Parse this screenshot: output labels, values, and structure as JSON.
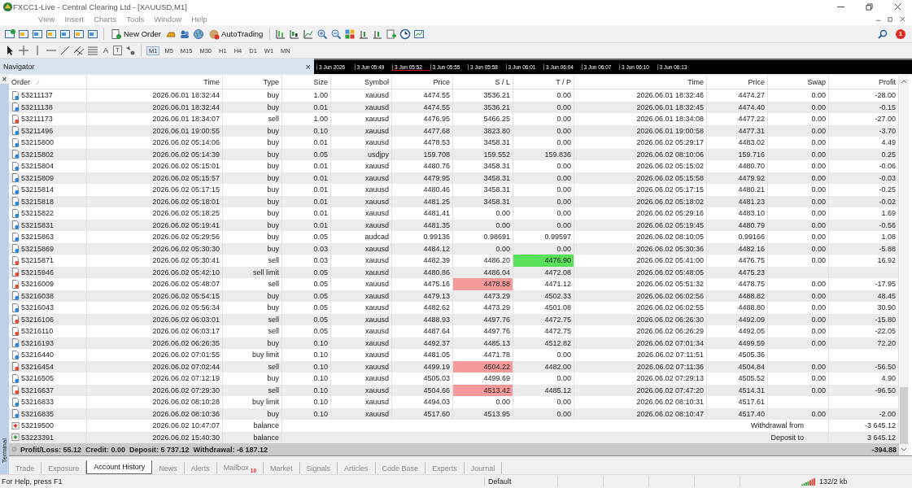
{
  "window": {
    "title": "FXCC1-Live - Central Clearing Ltd - [XAUUSD,M1]"
  },
  "menu": [
    "View",
    "Insert",
    "Charts",
    "Tools",
    "Window",
    "Help"
  ],
  "toolbar": {
    "new_order": "New Order",
    "autotrading": "AutoTrading",
    "notifications": "1"
  },
  "drawing_tools": {
    "text_tools": [
      "A",
      "T"
    ],
    "timeframes": [
      {
        "label": "M1",
        "selected": true
      },
      {
        "label": "M5",
        "selected": false
      },
      {
        "label": "M15",
        "selected": false
      },
      {
        "label": "M30",
        "selected": false
      },
      {
        "label": "H1",
        "selected": false
      },
      {
        "label": "H4",
        "selected": false
      },
      {
        "label": "D1",
        "selected": false
      },
      {
        "label": "W1",
        "selected": false
      },
      {
        "label": "MN",
        "selected": false
      }
    ]
  },
  "navigator": {
    "title": "Navigator",
    "close": "×"
  },
  "chart_strip": {
    "labels": [
      "3 Jun 2026",
      "3 Jun 05:49",
      "3 Jun 05:52",
      "3 Jun 05:55",
      "3 Jun 05:58",
      "3 Jun 06:01",
      "3 Jun 06:04",
      "3 Jun 06:07",
      "3 Jun 06:10",
      "3 Jun 06:13"
    ]
  },
  "terminal": {
    "label": "Terminal",
    "close": "×"
  },
  "table": {
    "columns": [
      "Order",
      "Time",
      "Type",
      "Size",
      "Symbol",
      "Price",
      "S / L",
      "T / P",
      "Time",
      "Price",
      "Swap",
      "Profit"
    ],
    "rows": [
      {
        "order": "53211137",
        "time": "2026.06.01 18:32:44",
        "type": "buy",
        "size": "1.00",
        "symbol": "xauusd",
        "price": "4474.55",
        "sl": "3536.21",
        "tp": "0.00",
        "close_time": "2026.06.01 18:32:46",
        "close_price": "4474.27",
        "swap": "0.00",
        "profit": "-28.00",
        "kind": "buy",
        "sl_hit": false,
        "tp_hit": false
      },
      {
        "order": "53211138",
        "time": "2026.06.01 18:32:44",
        "type": "buy",
        "size": "0.01",
        "symbol": "xauusd",
        "price": "4474.55",
        "sl": "3536.21",
        "tp": "0.00",
        "close_time": "2026.06.01 18:32:45",
        "close_price": "4474.40",
        "swap": "0.00",
        "profit": "-0.15",
        "kind": "buy",
        "sl_hit": false,
        "tp_hit": false
      },
      {
        "order": "53211173",
        "time": "2026.06.01 18:34:07",
        "type": "sell",
        "size": "1.00",
        "symbol": "xauusd",
        "price": "4476.95",
        "sl": "5466.25",
        "tp": "0.00",
        "close_time": "2026.06.01 18:34:08",
        "close_price": "4477.22",
        "swap": "0.00",
        "profit": "-27.00",
        "kind": "sell",
        "sl_hit": false,
        "tp_hit": false
      },
      {
        "order": "53211496",
        "time": "2026.06.01 19:00:55",
        "type": "buy",
        "size": "0.10",
        "symbol": "xauusd",
        "price": "4477.68",
        "sl": "3823.80",
        "tp": "0.00",
        "close_time": "2026.06.01 19:00:58",
        "close_price": "4477.31",
        "swap": "0.00",
        "profit": "-3.70",
        "kind": "buy",
        "sl_hit": false,
        "tp_hit": false
      },
      {
        "order": "53215800",
        "time": "2026.06.02 05:14:06",
        "type": "buy",
        "size": "0.01",
        "symbol": "xauusd",
        "price": "4478.53",
        "sl": "3458.31",
        "tp": "0.00",
        "close_time": "2026.06.02 05:29:17",
        "close_price": "4483.02",
        "swap": "0.00",
        "profit": "4.49",
        "kind": "buy",
        "sl_hit": false,
        "tp_hit": false
      },
      {
        "order": "53215802",
        "time": "2026.06.02 05:14:39",
        "type": "buy",
        "size": "0.05",
        "symbol": "usdjpy",
        "price": "159.708",
        "sl": "159.552",
        "tp": "159.836",
        "close_time": "2026.06.02 08:10:06",
        "close_price": "159.716",
        "swap": "0.00",
        "profit": "0.25",
        "kind": "buy",
        "sl_hit": false,
        "tp_hit": false
      },
      {
        "order": "53215804",
        "time": "2026.06.02 05:15:01",
        "type": "buy",
        "size": "0.01",
        "symbol": "xauusd",
        "price": "4480.76",
        "sl": "3458.31",
        "tp": "0.00",
        "close_time": "2026.06.02 05:15:02",
        "close_price": "4480.70",
        "swap": "0.00",
        "profit": "-0.06",
        "kind": "buy",
        "sl_hit": false,
        "tp_hit": false
      },
      {
        "order": "53215809",
        "time": "2026.06.02 05:15:57",
        "type": "buy",
        "size": "0.01",
        "symbol": "xauusd",
        "price": "4479.95",
        "sl": "3458.31",
        "tp": "0.00",
        "close_time": "2026.06.02 05:15:58",
        "close_price": "4479.92",
        "swap": "0.00",
        "profit": "-0.03",
        "kind": "buy",
        "sl_hit": false,
        "tp_hit": false
      },
      {
        "order": "53215814",
        "time": "2026.06.02 05:17:15",
        "type": "buy",
        "size": "0.01",
        "symbol": "xauusd",
        "price": "4480.46",
        "sl": "3458.31",
        "tp": "0.00",
        "close_time": "2026.06.02 05:17:15",
        "close_price": "4480.21",
        "swap": "0.00",
        "profit": "-0.25",
        "kind": "buy",
        "sl_hit": false,
        "tp_hit": false
      },
      {
        "order": "53215818",
        "time": "2026.06.02 05:18:01",
        "type": "buy",
        "size": "0.01",
        "symbol": "xauusd",
        "price": "4481.25",
        "sl": "3458.31",
        "tp": "0.00",
        "close_time": "2026.06.02 05:18:02",
        "close_price": "4481.23",
        "swap": "0.00",
        "profit": "-0.02",
        "kind": "buy",
        "sl_hit": false,
        "tp_hit": false
      },
      {
        "order": "53215822",
        "time": "2026.06.02 05:18:25",
        "type": "buy",
        "size": "0.01",
        "symbol": "xauusd",
        "price": "4481.41",
        "sl": "0.00",
        "tp": "0.00",
        "close_time": "2026.06.02 05:29:16",
        "close_price": "4483.10",
        "swap": "0.00",
        "profit": "1.69",
        "kind": "buy",
        "sl_hit": false,
        "tp_hit": false
      },
      {
        "order": "53215831",
        "time": "2026.06.02 05:19:41",
        "type": "buy",
        "size": "0.01",
        "symbol": "xauusd",
        "price": "4481.35",
        "sl": "0.00",
        "tp": "0.00",
        "close_time": "2026.06.02 05:19:45",
        "close_price": "4480.79",
        "swap": "0.00",
        "profit": "-0.56",
        "kind": "buy",
        "sl_hit": false,
        "tp_hit": false
      },
      {
        "order": "53215863",
        "time": "2026.06.02 05:29:56",
        "type": "buy",
        "size": "0.05",
        "symbol": "audcad",
        "price": "0.99136",
        "sl": "0.98691",
        "tp": "0.99597",
        "close_time": "2026.06.02 08:10:05",
        "close_price": "0.99166",
        "swap": "0.00",
        "profit": "1.08",
        "kind": "buy",
        "sl_hit": false,
        "tp_hit": false
      },
      {
        "order": "53215869",
        "time": "2026.06.02 05:30:30",
        "type": "buy",
        "size": "0.03",
        "symbol": "xauusd",
        "price": "4484.12",
        "sl": "0.00",
        "tp": "0.00",
        "close_time": "2026.06.02 05:30:36",
        "close_price": "4482.16",
        "swap": "0.00",
        "profit": "-5.88",
        "kind": "buy",
        "sl_hit": false,
        "tp_hit": false
      },
      {
        "order": "53215871",
        "time": "2026.06.02 05:30:41",
        "type": "sell",
        "size": "0.03",
        "symbol": "xauusd",
        "price": "4482.39",
        "sl": "4486.20",
        "tp": "4476.90",
        "close_time": "2026.06.02 05:41:00",
        "close_price": "4476.75",
        "swap": "0.00",
        "profit": "16.92",
        "kind": "sell",
        "sl_hit": false,
        "tp_hit": true
      },
      {
        "order": "53215946",
        "time": "2026.06.02 05:42:10",
        "type": "sell limit",
        "size": "0.05",
        "symbol": "xauusd",
        "price": "4480.86",
        "sl": "4486.04",
        "tp": "4472.08",
        "close_time": "2026.06.02 05:48:05",
        "close_price": "4475.23",
        "kind": "sell",
        "sl_hit": false,
        "tp_hit": false
      },
      {
        "order": "53216009",
        "time": "2026.06.02 05:48:07",
        "type": "sell",
        "size": "0.05",
        "symbol": "xauusd",
        "price": "4475.16",
        "sl": "4478.58",
        "tp": "4471.12",
        "close_time": "2026.06.02 05:51:32",
        "close_price": "4478.75",
        "swap": "0.00",
        "profit": "-17.95",
        "kind": "sell",
        "sl_hit": true,
        "tp_hit": false
      },
      {
        "order": "53216038",
        "time": "2026.06.02 05:54:15",
        "type": "buy",
        "size": "0.05",
        "symbol": "xauusd",
        "price": "4479.13",
        "sl": "4473.29",
        "tp": "4502.33",
        "close_time": "2026.06.02 06:02:56",
        "close_price": "4488.82",
        "swap": "0.00",
        "profit": "48.45",
        "kind": "buy",
        "sl_hit": false,
        "tp_hit": false
      },
      {
        "order": "53216043",
        "time": "2026.06.02 05:56:34",
        "type": "buy",
        "size": "0.05",
        "symbol": "xauusd",
        "price": "4482.62",
        "sl": "4473.29",
        "tp": "4501.08",
        "close_time": "2026.06.02 06:02:55",
        "close_price": "4488.80",
        "swap": "0.00",
        "profit": "30.90",
        "kind": "buy",
        "sl_hit": false,
        "tp_hit": false
      },
      {
        "order": "53216106",
        "time": "2026.06.02 06:03:01",
        "type": "sell",
        "size": "0.05",
        "symbol": "xauusd",
        "price": "4488.93",
        "sl": "4497.76",
        "tp": "4472.75",
        "close_time": "2026.06.02 06:26:30",
        "close_price": "4492.09",
        "swap": "0.00",
        "profit": "-15.80",
        "kind": "sell",
        "sl_hit": false,
        "tp_hit": false
      },
      {
        "order": "53216110",
        "time": "2026.06.02 06:03:17",
        "type": "sell",
        "size": "0.05",
        "symbol": "xauusd",
        "price": "4487.64",
        "sl": "4497.76",
        "tp": "4472.75",
        "close_time": "2026.06.02 06:26:29",
        "close_price": "4492.05",
        "swap": "0.00",
        "profit": "-22.05",
        "kind": "sell",
        "sl_hit": false,
        "tp_hit": false
      },
      {
        "order": "53216193",
        "time": "2026.06.02 06:26:35",
        "type": "buy",
        "size": "0.10",
        "symbol": "xauusd",
        "price": "4492.37",
        "sl": "4485.13",
        "tp": "4512.82",
        "close_time": "2026.06.02 07:01:34",
        "close_price": "4499.59",
        "swap": "0.00",
        "profit": "72.20",
        "kind": "buy",
        "sl_hit": false,
        "tp_hit": false
      },
      {
        "order": "53216440",
        "time": "2026.06.02 07:01:55",
        "type": "buy limit",
        "size": "0.10",
        "symbol": "xauusd",
        "price": "4481.05",
        "sl": "4471.78",
        "tp": "0.00",
        "close_time": "2026.06.02 07:11:51",
        "close_price": "4505.36",
        "kind": "buy",
        "sl_hit": false,
        "tp_hit": false
      },
      {
        "order": "53216454",
        "time": "2026.06.02 07:02:44",
        "type": "sell",
        "size": "0.10",
        "symbol": "xauusd",
        "price": "4499.19",
        "sl": "4504.22",
        "tp": "4482.00",
        "close_time": "2026.06.02 07:11:36",
        "close_price": "4504.84",
        "swap": "0.00",
        "profit": "-56.50",
        "kind": "sell",
        "sl_hit": true,
        "tp_hit": false
      },
      {
        "order": "53216505",
        "time": "2026.06.02 07:12:19",
        "type": "buy",
        "size": "0.10",
        "symbol": "xauusd",
        "price": "4505.03",
        "sl": "4499.69",
        "tp": "0.00",
        "close_time": "2026.06.02 07:29:13",
        "close_price": "4505.52",
        "swap": "0.00",
        "profit": "4.90",
        "kind": "buy",
        "sl_hit": false,
        "tp_hit": false
      },
      {
        "order": "53216637",
        "time": "2026.06.02 07:29:30",
        "type": "sell",
        "size": "0.10",
        "symbol": "xauusd",
        "price": "4504.66",
        "sl": "4513.42",
        "tp": "4485.12",
        "close_time": "2026.06.02 07:47:20",
        "close_price": "4514.31",
        "swap": "0.00",
        "profit": "-96.50",
        "kind": "sell",
        "sl_hit": true,
        "tp_hit": false
      },
      {
        "order": "53216833",
        "time": "2026.06.02 08:10:28",
        "type": "buy limit",
        "size": "0.10",
        "symbol": "xauusd",
        "price": "4494.03",
        "sl": "0.00",
        "tp": "0.00",
        "close_time": "2026.06.02 08:10:31",
        "close_price": "4517.61",
        "kind": "buy",
        "sl_hit": false,
        "tp_hit": false
      },
      {
        "order": "53216835",
        "time": "2026.06.02 08:10:36",
        "type": "buy",
        "size": "0.10",
        "symbol": "xauusd",
        "price": "4517.60",
        "sl": "4513.95",
        "tp": "0.00",
        "close_time": "2026.06.02 08:10:47",
        "close_price": "4517.40",
        "swap": "0.00",
        "profit": "-2.00",
        "kind": "buy",
        "sl_hit": false,
        "tp_hit": false
      },
      {
        "order": "53219500",
        "time": "2026.06.02 10:47:07",
        "type": "balance",
        "comment": "Withdrawal from",
        "profit": "-3 645.12",
        "kind": "withdrawal"
      },
      {
        "order": "53223391",
        "time": "2026.06.02 15:40:30",
        "type": "balance",
        "comment": "Deposit to",
        "profit": "3 645.12",
        "kind": "deposit"
      }
    ],
    "summary": {
      "text": "Profit/Loss: 55.12  Credit: 0.00  Deposit: 5 737.12  Withdrawal: -6 187.12",
      "total": "-394.88"
    }
  },
  "tabs": [
    {
      "label": "Trade",
      "selected": false
    },
    {
      "label": "Exposure",
      "selected": false
    },
    {
      "label": "Account History",
      "selected": true
    },
    {
      "label": "News",
      "selected": false
    },
    {
      "label": "Alerts",
      "selected": false
    },
    {
      "label": "Mailbox",
      "selected": false,
      "badge": "10"
    },
    {
      "label": "Market",
      "selected": false
    },
    {
      "label": "Signals",
      "selected": false
    },
    {
      "label": "Articles",
      "selected": false
    },
    {
      "label": "Code Base",
      "selected": false
    },
    {
      "label": "Experts",
      "selected": false
    },
    {
      "label": "Journal",
      "selected": false
    }
  ],
  "status_bar": {
    "help": "For Help, press F1",
    "profile": "Default",
    "traffic": "132/2 kb"
  }
}
